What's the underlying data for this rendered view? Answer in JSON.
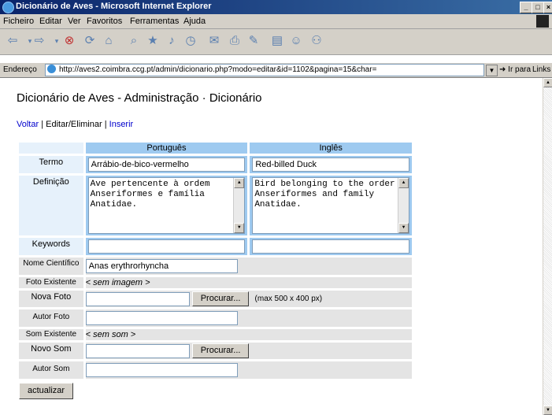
{
  "window": {
    "title": "Dicionário de Aves - Microsoft Internet Explorer"
  },
  "menu": [
    "Ficheiro",
    "Editar",
    "Ver",
    "Favoritos",
    "Ferramentas",
    "Ajuda"
  ],
  "address": {
    "label": "Endereço",
    "url": "http://aves2.coimbra.ccg.pt/admin/dicionario.php?modo=editar&id=1102&pagina=15&char=",
    "go": "Ir para",
    "links": "Links »"
  },
  "page": {
    "title": "Dicionário de Aves - Administração · Dicionário",
    "nav": {
      "back": "Voltar",
      "separator": " | ",
      "current": "Editar/Eliminar",
      "insert": "Inserir"
    }
  },
  "form": {
    "headers": {
      "pt": "Português",
      "en": "Inglês"
    },
    "term": {
      "label": "Termo",
      "pt": "Arrábio-de-bico-vermelho",
      "en": "Red-billed Duck"
    },
    "definition": {
      "label": "Definição",
      "pt": "Ave pertencente à ordem Anseriformes e família Anatidae.",
      "en": "Bird belonging to the order Anseriformes and family Anatidae."
    },
    "keywords": {
      "label": "Keywords",
      "pt": "",
      "en": ""
    },
    "scientific_name": {
      "label": "Nome Científico",
      "value": "Anas erythrorhyncha"
    },
    "photo_existing": {
      "label": "Foto Existente",
      "value": "< sem imagem >"
    },
    "new_photo": {
      "label": "Nova Foto",
      "browse": "Procurar...",
      "hint": "(max 500 x 400 px)"
    },
    "photo_author": {
      "label": "Autor Foto",
      "value": ""
    },
    "sound_existing": {
      "label": "Som Existente",
      "value": "< sem som >"
    },
    "new_sound": {
      "label": "Novo Som",
      "browse": "Procurar..."
    },
    "sound_author": {
      "label": "Autor Som",
      "value": ""
    },
    "submit": "actualizar"
  }
}
